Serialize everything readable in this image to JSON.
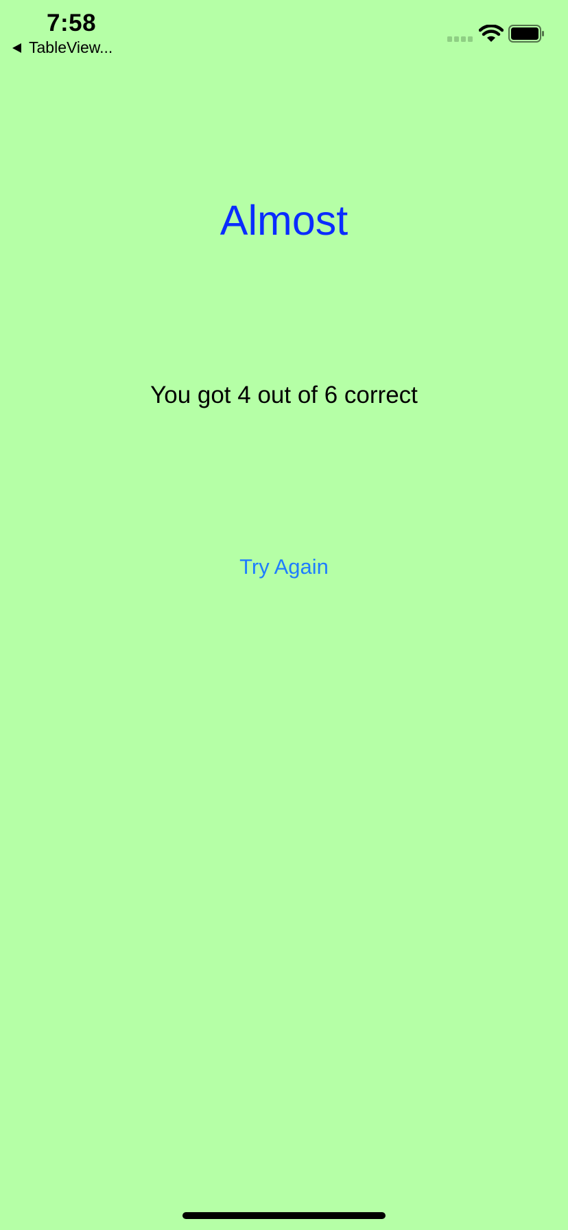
{
  "status_bar": {
    "time": "7:58",
    "back_label": "TableView...",
    "signal_icon": "signal-icon",
    "wifi_icon": "wifi-icon",
    "battery_icon": "battery-icon"
  },
  "result": {
    "headline": "Almost",
    "score_text": "You got 4 out of 6 correct",
    "try_again_label": "Try Again"
  },
  "colors": {
    "background": "#b5ffa6",
    "headline": "#0a2cff",
    "link": "#1e7dff",
    "text": "#000000"
  }
}
